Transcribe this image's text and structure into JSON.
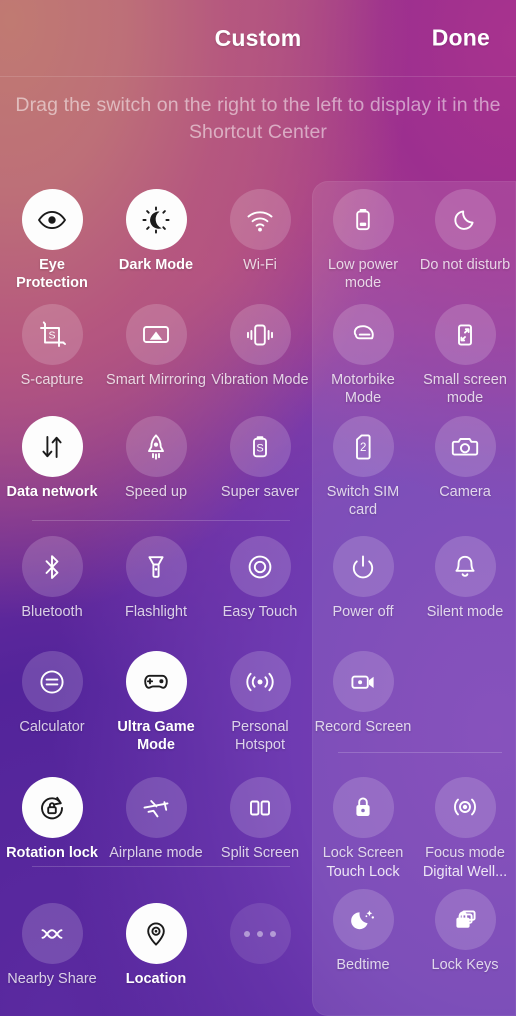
{
  "header": {
    "title": "Custom",
    "done_label": "Done",
    "hint": "Drag the switch on the right to the left to display it in the Shortcut Center"
  },
  "colors": {
    "accent_on_bg": "#fdfdfd",
    "accent_on_fg": "#1b1b1b",
    "tile_bg": "rgba(255,255,255,0.17)",
    "panel_bg": "rgba(255,255,255,0.10)",
    "text": "#ffffff",
    "hint_text": "rgba(255,255,255,0.52)",
    "gradient_start": "#b96f79",
    "gradient_mid": "#8e38a2",
    "gradient_end": "#4f2397"
  },
  "left_grid": {
    "name": "shortcut-center-grid",
    "tiles": [
      {
        "label": "Eye Protection",
        "icon": "eye-icon",
        "state": "on"
      },
      {
        "label": "Dark Mode",
        "icon": "dark-mode-icon",
        "state": "on"
      },
      {
        "label": "Wi-Fi",
        "icon": "wifi-icon",
        "state": "off"
      },
      {
        "label": "S-capture",
        "icon": "s-capture-icon",
        "state": "off"
      },
      {
        "label": "Smart Mirroring",
        "icon": "cast-icon",
        "state": "off"
      },
      {
        "label": "Vibration Mode",
        "icon": "vibration-icon",
        "state": "off"
      },
      {
        "label": "Data network",
        "icon": "data-arrows-icon",
        "state": "on"
      },
      {
        "label": "Speed up",
        "icon": "rocket-icon",
        "state": "off"
      },
      {
        "label": "Super saver",
        "icon": "battery-s-icon",
        "state": "off"
      },
      {
        "label": "Bluetooth",
        "icon": "bluetooth-icon",
        "state": "off"
      },
      {
        "label": "Flashlight",
        "icon": "flashlight-icon",
        "state": "off"
      },
      {
        "label": "Easy Touch",
        "icon": "easy-touch-icon",
        "state": "off"
      },
      {
        "label": "Calculator",
        "icon": "calculator-icon",
        "state": "off"
      },
      {
        "label": "Ultra Game Mode",
        "icon": "gamepad-icon",
        "state": "on"
      },
      {
        "label": "Personal Hotspot",
        "icon": "hotspot-icon",
        "state": "off"
      },
      {
        "label": "Rotation lock",
        "icon": "rotation-lock-icon",
        "state": "on"
      },
      {
        "label": "Airplane mode",
        "icon": "airplane-icon",
        "state": "off"
      },
      {
        "label": "Split Screen",
        "icon": "split-screen-icon",
        "state": "off"
      },
      {
        "label": "Nearby Share",
        "icon": "nearby-share-icon",
        "state": "off"
      },
      {
        "label": "Location",
        "icon": "location-pin-icon",
        "state": "on"
      },
      {
        "label": "",
        "icon": "more-dots-icon",
        "state": "faint"
      }
    ]
  },
  "right_panel": {
    "name": "available-switches-panel",
    "tiles": [
      {
        "label": "Low power mode",
        "icon": "battery-icon",
        "sublabel": ""
      },
      {
        "label": "Do not disturb",
        "icon": "moon-icon",
        "sublabel": ""
      },
      {
        "label": "Motorbike Mode",
        "icon": "helmet-icon",
        "sublabel": ""
      },
      {
        "label": "Small screen mode",
        "icon": "small-screen-icon",
        "sublabel": ""
      },
      {
        "label": "Switch SIM card",
        "icon": "sim-card-2-icon",
        "sublabel": ""
      },
      {
        "label": "Camera",
        "icon": "camera-icon",
        "sublabel": ""
      },
      {
        "label": "Power off",
        "icon": "power-icon",
        "sublabel": ""
      },
      {
        "label": "Silent mode",
        "icon": "bell-icon",
        "sublabel": ""
      },
      {
        "label": "Record Screen",
        "icon": "video-camera-icon",
        "sublabel": ""
      },
      {
        "label": "Lock Screen",
        "icon": "padlock-icon",
        "sublabel": "Touch Lock"
      },
      {
        "label": "Focus mode",
        "icon": "focus-mode-icon",
        "sublabel": "Digital Well..."
      },
      {
        "label": "Bedtime",
        "icon": "bedtime-moon-icon",
        "sublabel": ""
      },
      {
        "label": "Lock Keys",
        "icon": "lock-keys-icon",
        "sublabel": ""
      }
    ]
  }
}
